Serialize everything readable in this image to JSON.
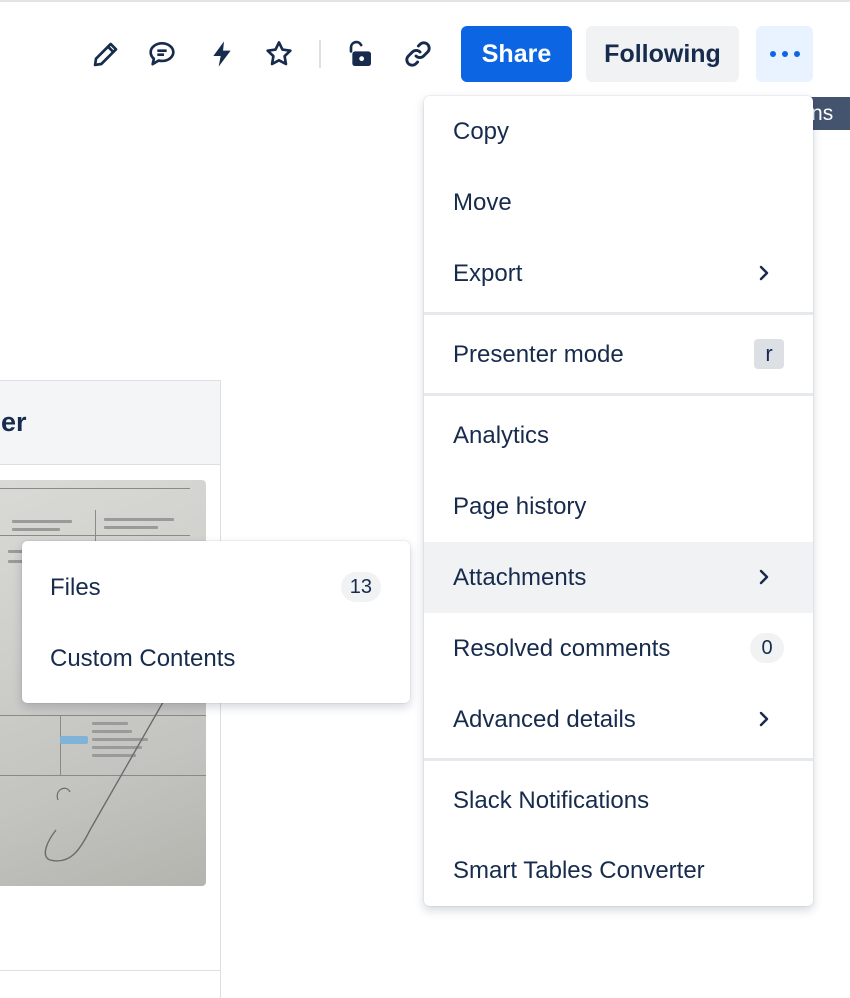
{
  "toolbar": {
    "icons": [
      "edit-icon",
      "comment-icon",
      "automation-icon",
      "star-icon",
      "restrictions-icon",
      "link-icon"
    ],
    "share_label": "Share",
    "following_label": "Following",
    "more_tooltip": "More actions",
    "accent": "#0c66e4"
  },
  "page": {
    "table_header": "er"
  },
  "menu": {
    "copy": "Copy",
    "move": "Move",
    "export": "Export",
    "presenter_mode": "Presenter mode",
    "presenter_shortcut": "r",
    "analytics": "Analytics",
    "page_history": "Page history",
    "attachments": "Attachments",
    "resolved_comments": "Resolved comments",
    "resolved_count": "0",
    "advanced_details": "Advanced details",
    "slack_notifications": "Slack Notifications",
    "smart_tables": "Smart Tables Converter"
  },
  "submenu": {
    "files": "Files",
    "files_count": "13",
    "custom_contents": "Custom Contents"
  }
}
